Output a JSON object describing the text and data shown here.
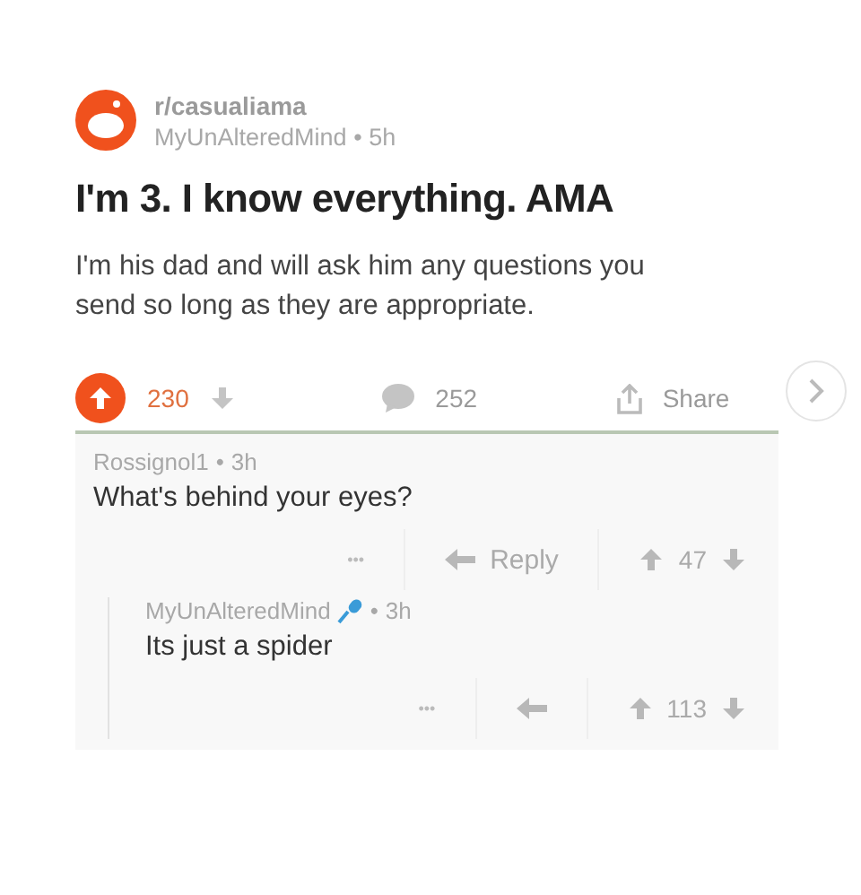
{
  "post": {
    "subreddit": "r/casualiama",
    "author": "MyUnAlteredMind",
    "sep": "•",
    "age": "5h",
    "title": "I'm 3. I know everything. AMA",
    "body": "I'm his dad and will ask him any questions you send so long as they are appropriate."
  },
  "actions": {
    "upvoted": true,
    "score": "230",
    "comments": "252",
    "share": "Share"
  },
  "comments": [
    {
      "author": "Rossignol1",
      "sep": "•",
      "age": "3h",
      "mic": false,
      "text": "What's behind your eyes?",
      "more": "•••",
      "reply": "Reply",
      "score": "47",
      "children": [
        {
          "author": "MyUnAlteredMind",
          "sep": "•",
          "age": "3h",
          "mic": true,
          "text": "Its just a spider",
          "more": "•••",
          "score": "113"
        }
      ]
    }
  ]
}
